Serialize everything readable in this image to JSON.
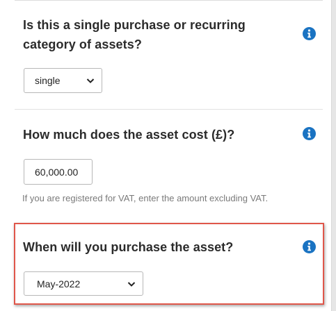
{
  "questions": [
    {
      "label_line1": "Is this a single purchase or recurring",
      "label_line2": "category of assets?",
      "control": "select",
      "value": "single",
      "info_icon": "info-circle-icon"
    },
    {
      "label_line1": "How much does the asset cost (£)?",
      "control": "text",
      "value": "60,000.00",
      "hint": "If you are registered for VAT, enter the amount excluding VAT.",
      "info_icon": "info-circle-icon"
    },
    {
      "label_line1": "When will you purchase the asset?",
      "control": "select",
      "value": "May-2022",
      "info_icon": "info-circle-icon",
      "highlighted": true
    }
  ],
  "colors": {
    "info_icon": "#1a73c2",
    "highlight_border": "#e0564a",
    "label": "#2b2b2b",
    "hint": "#7a7a7a"
  }
}
